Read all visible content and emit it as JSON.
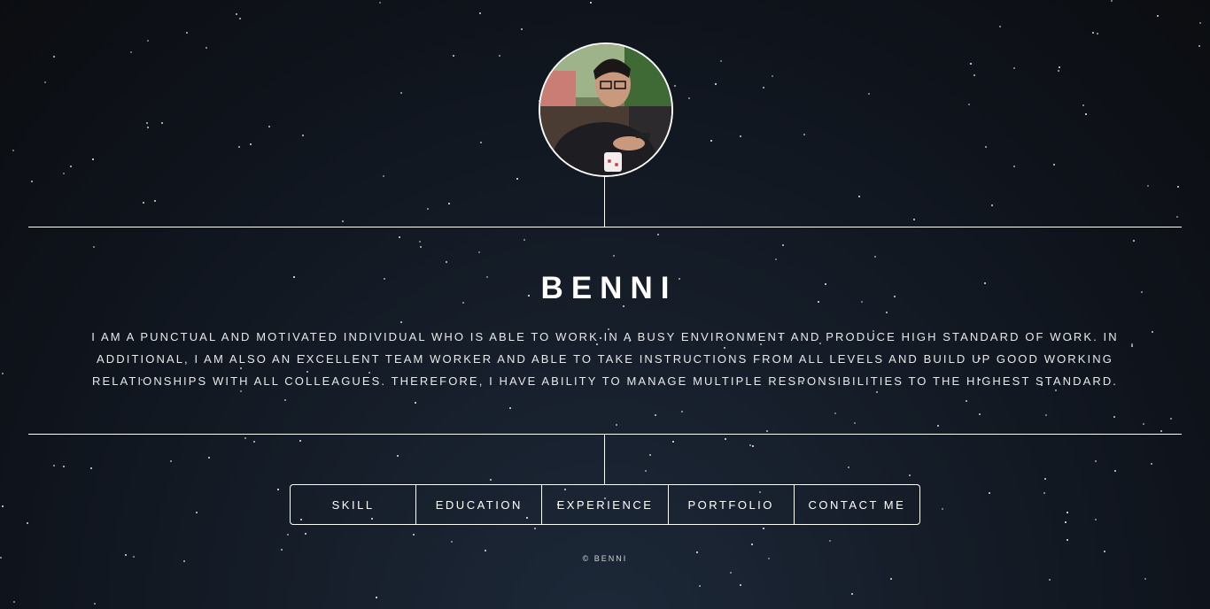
{
  "profile": {
    "name": "BENNI",
    "bio": "I AM A PUNCTUAL AND MOTIVATED INDIVIDUAL WHO IS ABLE TO WORK IN A BUSY ENVIRONMENT AND PRODUCE HIGH STANDARD OF WORK. IN ADDITIONAL, I AM ALSO AN EXCELLENT TEAM WORKER AND ABLE TO TAKE INSTRUCTIONS FROM ALL LEVELS AND BUILD UP GOOD WORKING RELATIONSHIPS WITH ALL COLLEAGUES. THEREFORE, I HAVE ABILITY TO MANAGE MULTIPLE RESPONSIBILITIES TO THE HIGHEST STANDARD."
  },
  "nav": {
    "items": [
      {
        "label": "SKILL"
      },
      {
        "label": "EDUCATION"
      },
      {
        "label": "EXPERIENCE"
      },
      {
        "label": "PORTFOLIO"
      },
      {
        "label": "CONTACT ME"
      }
    ]
  },
  "footer": {
    "copyright": "© BENNI"
  },
  "colors": {
    "background": "#0f141c",
    "accent": "#ffffff"
  }
}
